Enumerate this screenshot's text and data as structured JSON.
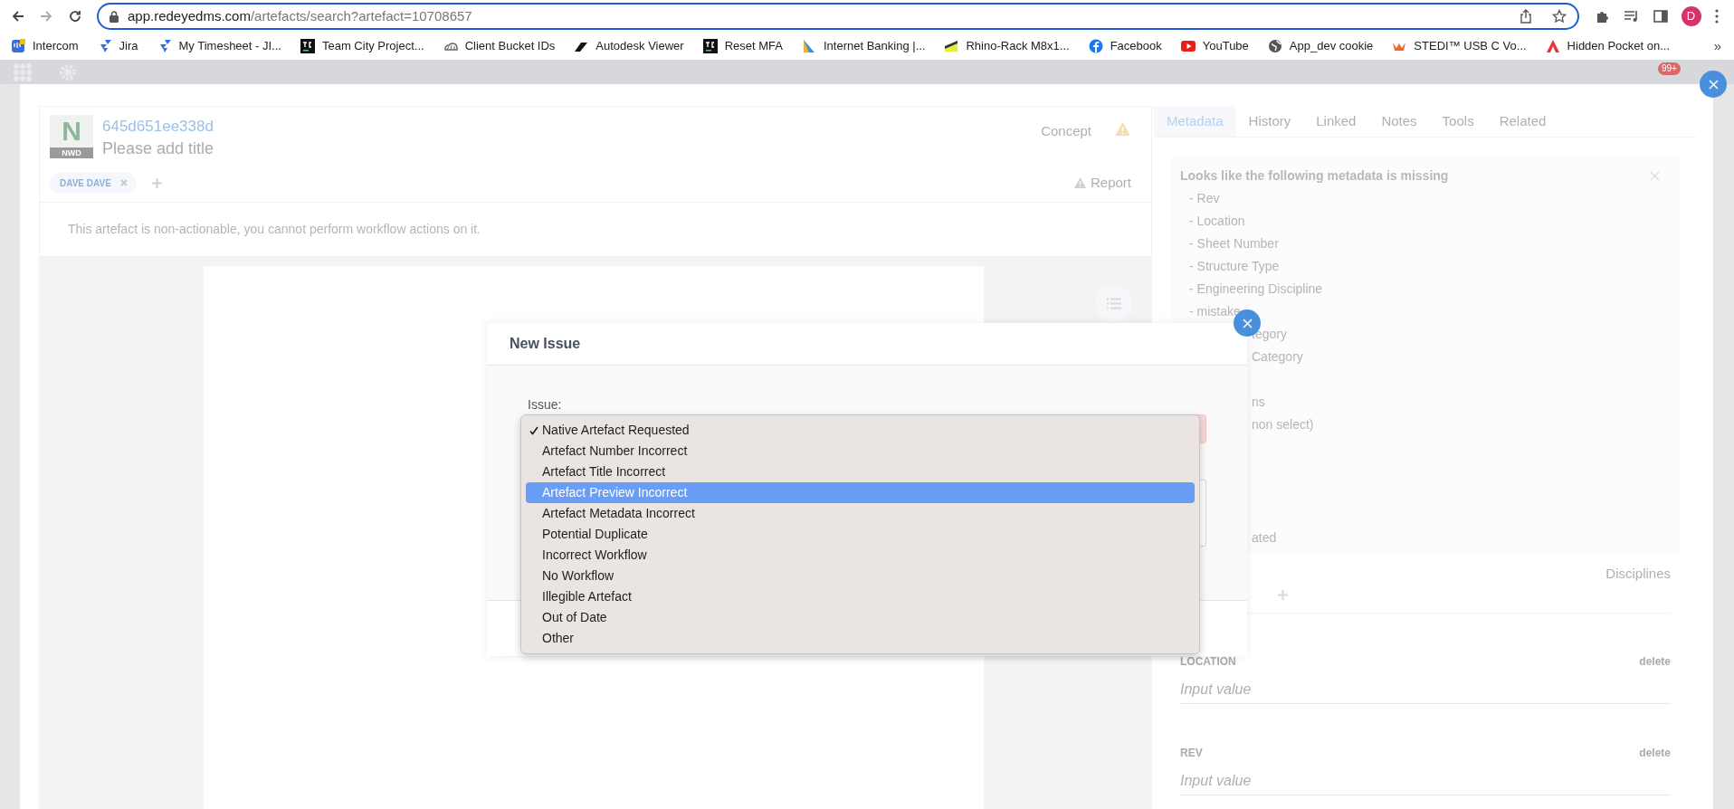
{
  "browser": {
    "url_host": "app.redeyedms.com",
    "url_path": "/artefacts/search?artefact=10708657",
    "profile_initial": "D"
  },
  "bookmarks": [
    {
      "label": "Intercom",
      "kind": "chat"
    },
    {
      "label": "Jira",
      "kind": "arrows"
    },
    {
      "label": "My Timesheet - JI...",
      "kind": "arrows"
    },
    {
      "label": "Team City Project...",
      "kind": "tc"
    },
    {
      "label": "Client Bucket IDs",
      "kind": "cloud"
    },
    {
      "label": "Autodesk Viewer",
      "kind": "swoosh"
    },
    {
      "label": "Reset MFA",
      "kind": "tc"
    },
    {
      "label": "Internet Banking |...",
      "kind": "wedge"
    },
    {
      "label": "Rhino-Rack M8x1...",
      "kind": "stripe"
    },
    {
      "label": "Facebook",
      "kind": "fcircle"
    },
    {
      "label": "YouTube",
      "kind": "play"
    },
    {
      "label": "App_dev cookie",
      "kind": "globe"
    },
    {
      "label": "STEDI™ USB C Vo...",
      "kind": "wing"
    },
    {
      "label": "Hidden Pocket on...",
      "kind": "peak"
    }
  ],
  "bookmarks_overflow": "»",
  "app_header": {
    "badge": "99+"
  },
  "artefact": {
    "number": "645d651ee338d",
    "title": "Please add title",
    "file_letter": "N",
    "file_type": "NWD",
    "status": "Concept",
    "tags": [
      {
        "label": "DAVE DAVE"
      }
    ],
    "report": "Report",
    "notice": "This artefact is non-actionable, you cannot perform workflow actions on it."
  },
  "tabs": [
    {
      "label": "Metadata",
      "selected": true
    },
    {
      "label": "History",
      "selected": false
    },
    {
      "label": "Linked",
      "selected": false
    },
    {
      "label": "Notes",
      "selected": false
    },
    {
      "label": "Tools",
      "selected": false
    },
    {
      "label": "Related",
      "selected": false
    }
  ],
  "missing_alert": {
    "title": "Looks like the following metadata is missing",
    "items": [
      {
        "kind": "full",
        "text": "- Rev"
      },
      {
        "kind": "full",
        "text": "- Location"
      },
      {
        "kind": "full",
        "text": "- Sheet Number"
      },
      {
        "kind": "full",
        "text": "- Structure Type"
      },
      {
        "kind": "full",
        "text": "- Engineering Discipline"
      },
      {
        "kind": "full",
        "text": "- mistake"
      },
      {
        "kind": "clipped",
        "text": "tegory"
      },
      {
        "kind": "clipped",
        "text": "Category"
      },
      {
        "kind": "covered"
      },
      {
        "kind": "clipped",
        "text": "ns"
      },
      {
        "kind": "clipped",
        "text": "non select)"
      },
      {
        "kind": "covered"
      },
      {
        "kind": "covered"
      },
      {
        "kind": "covered"
      },
      {
        "kind": "covered"
      },
      {
        "kind": "clipped",
        "text": "ated"
      }
    ]
  },
  "disciplines_label": "Disciplines",
  "fields": [
    {
      "label": "LOCATION",
      "action": "delete",
      "placeholder": "Input value"
    },
    {
      "label": "REV",
      "action": "delete",
      "placeholder": "Input value"
    }
  ],
  "modal": {
    "title": "New Issue",
    "issue_label": "Issue:",
    "options": [
      {
        "label": "Native Artefact Requested",
        "checked": true,
        "highlighted": false
      },
      {
        "label": "Artefact Number Incorrect",
        "checked": false,
        "highlighted": false
      },
      {
        "label": "Artefact Title Incorrect",
        "checked": false,
        "highlighted": false
      },
      {
        "label": "Artefact Preview Incorrect",
        "checked": false,
        "highlighted": true
      },
      {
        "label": "Artefact Metadata Incorrect",
        "checked": false,
        "highlighted": false
      },
      {
        "label": "Potential Duplicate",
        "checked": false,
        "highlighted": false
      },
      {
        "label": "Incorrect Workflow",
        "checked": false,
        "highlighted": false
      },
      {
        "label": "No Workflow",
        "checked": false,
        "highlighted": false
      },
      {
        "label": "Illegible Artefact",
        "checked": false,
        "highlighted": false
      },
      {
        "label": "Out of Date",
        "checked": false,
        "highlighted": false
      },
      {
        "label": "Other",
        "checked": false,
        "highlighted": false
      }
    ]
  }
}
